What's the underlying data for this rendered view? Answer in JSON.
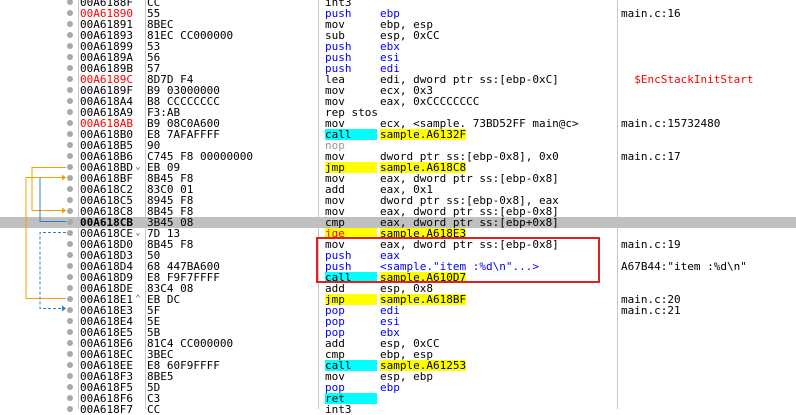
{
  "colors": {
    "selection_row": "#c0c0c0",
    "call_highlight": "#00ffff",
    "jump_highlight": "#ffff00",
    "address_label": "#ff0000",
    "annotation_box": "#e02020",
    "jump_arrow_orange": "#f0a000",
    "jump_arrow_blue": "#3080c0"
  },
  "rows": [
    {
      "addr": "00A6188F",
      "bytes": "CC",
      "mn": "int3",
      "ops": "",
      "cm": ""
    },
    {
      "addr": "00A61890",
      "bytes": "55",
      "mn": "push",
      "ops": "ebp",
      "cm": "main.c:16"
    },
    {
      "addr": "00A61891",
      "bytes": "8BEC",
      "mn": "mov",
      "ops": "ebp, esp",
      "cm": ""
    },
    {
      "addr": "00A61893",
      "bytes": "81EC CC000000",
      "mn": "sub",
      "ops": "esp, 0xCC",
      "cm": ""
    },
    {
      "addr": "00A61899",
      "bytes": "53",
      "mn": "push",
      "ops": "ebx",
      "cm": ""
    },
    {
      "addr": "00A6189A",
      "bytes": "56",
      "mn": "push",
      "ops": "esi",
      "cm": ""
    },
    {
      "addr": "00A6189B",
      "bytes": "57",
      "mn": "push",
      "ops": "edi",
      "cm": ""
    },
    {
      "addr": "00A6189C",
      "bytes": "8D7D F4",
      "mn": "lea",
      "ops": "edi, dword ptr ss:[ebp-0xC]",
      "cm": "__$EncStackInitStart"
    },
    {
      "addr": "00A6189F",
      "bytes": "B9 03000000",
      "mn": "mov",
      "ops": "ecx, 0x3",
      "cm": ""
    },
    {
      "addr": "00A618A4",
      "bytes": "B8 CCCCCCCC",
      "mn": "mov",
      "ops": "eax, 0xCCCCCCCC",
      "cm": ""
    },
    {
      "addr": "00A618A9",
      "bytes": "F3:AB",
      "mn": "rep stosd",
      "ops": "",
      "cm": ""
    },
    {
      "addr": "00A618AB",
      "bytes": "B9 08C0A600",
      "mn": "mov",
      "ops": "ecx, <sample._73BD52FF_main@c>",
      "cm": "main.c:15732480"
    },
    {
      "addr": "00A618B0",
      "bytes": "E8 7AFAFFFF",
      "mn": "call",
      "ops": "sample.A6132F",
      "cm": ""
    },
    {
      "addr": "00A618B5",
      "bytes": "90",
      "mn": "nop",
      "ops": "",
      "cm": ""
    },
    {
      "addr": "00A618B6",
      "bytes": "C745 F8 00000000",
      "mn": "mov",
      "ops": "dword ptr ss:[ebp-0x8], 0x0",
      "cm": "main.c:17"
    },
    {
      "addr": "00A618BD",
      "bytes": "EB 09",
      "mn": "jmp",
      "ops": "sample.A618C8",
      "cm": ""
    },
    {
      "addr": "00A618BF",
      "bytes": "8B45 F8",
      "mn": "mov",
      "ops": "eax, dword ptr ss:[ebp-0x8]",
      "cm": ""
    },
    {
      "addr": "00A618C2",
      "bytes": "83C0 01",
      "mn": "add",
      "ops": "eax, 0x1",
      "cm": ""
    },
    {
      "addr": "00A618C5",
      "bytes": "8945 F8",
      "mn": "mov",
      "ops": "dword ptr ss:[ebp-0x8], eax",
      "cm": ""
    },
    {
      "addr": "00A618C8",
      "bytes": "8B45 F8",
      "mn": "mov",
      "ops": "eax, dword ptr ss:[ebp-0x8]",
      "cm": ""
    },
    {
      "addr": "00A618CB",
      "bytes": "3B45 08",
      "mn": "cmp",
      "ops": "eax, dword ptr ss:[ebp+0x8]",
      "cm": ""
    },
    {
      "addr": "00A618CE",
      "bytes": "7D 13",
      "mn": "jge",
      "ops": "sample.A618E3",
      "cm": ""
    },
    {
      "addr": "00A618D0",
      "bytes": "8B45 F8",
      "mn": "mov",
      "ops": "eax, dword ptr ss:[ebp-0x8]",
      "cm": "main.c:19"
    },
    {
      "addr": "00A618D3",
      "bytes": "50",
      "mn": "push",
      "ops": "eax",
      "cm": ""
    },
    {
      "addr": "00A618D4",
      "bytes": "68 447BA600",
      "mn": "push",
      "ops": "<sample.\"item :%d\\n\"...>",
      "cm": "A67B44:\"item :%d\\n\""
    },
    {
      "addr": "00A618D9",
      "bytes": "E8 F9F7FFFF",
      "mn": "call",
      "ops": "sample.A610D7",
      "cm": ""
    },
    {
      "addr": "00A618DE",
      "bytes": "83C4 08",
      "mn": "add",
      "ops": "esp, 0x8",
      "cm": ""
    },
    {
      "addr": "00A618E1",
      "bytes": "EB DC",
      "mn": "jmp",
      "ops": "sample.A618BF",
      "cm": "main.c:20"
    },
    {
      "addr": "00A618E3",
      "bytes": "5F",
      "mn": "pop",
      "ops": "edi",
      "cm": "main.c:21"
    },
    {
      "addr": "00A618E4",
      "bytes": "5E",
      "mn": "pop",
      "ops": "esi",
      "cm": ""
    },
    {
      "addr": "00A618E5",
      "bytes": "5B",
      "mn": "pop",
      "ops": "ebx",
      "cm": ""
    },
    {
      "addr": "00A618E6",
      "bytes": "81C4 CC000000",
      "mn": "add",
      "ops": "esp, 0xCC",
      "cm": ""
    },
    {
      "addr": "00A618EC",
      "bytes": "3BEC",
      "mn": "cmp",
      "ops": "ebp, esp",
      "cm": ""
    },
    {
      "addr": "00A618EE",
      "bytes": "E8 60F9FFFF",
      "mn": "call",
      "ops": "sample.A61253",
      "cm": ""
    },
    {
      "addr": "00A618F3",
      "bytes": "8BE5",
      "mn": "mov",
      "ops": "esp, ebp",
      "cm": ""
    },
    {
      "addr": "00A618F5",
      "bytes": "5D",
      "mn": "pop",
      "ops": "ebp",
      "cm": ""
    },
    {
      "addr": "00A618F6",
      "bytes": "C3",
      "mn": "ret",
      "ops": "",
      "cm": ""
    },
    {
      "addr": "00A618F7",
      "bytes": "CC",
      "mn": "int3",
      "ops": "",
      "cm": ""
    }
  ]
}
